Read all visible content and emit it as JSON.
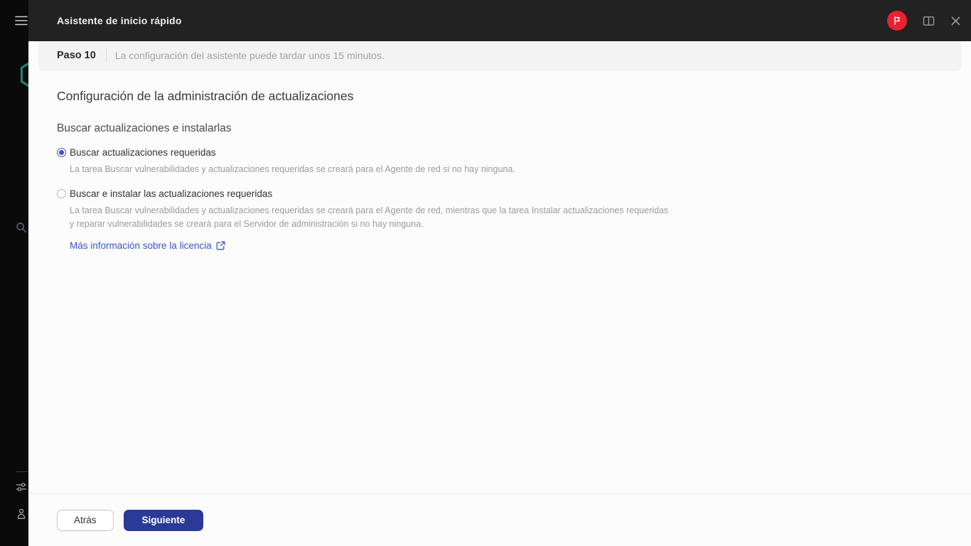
{
  "topbar": {
    "title": "Asistente de inicio rápido"
  },
  "stepbar": {
    "step": "Paso 10",
    "note": "La configuración del asistente puede tardar unos 15 minutos."
  },
  "content": {
    "heading": "Configuración de la administración de actualizaciones",
    "subheading": "Buscar actualizaciones e instalarlas",
    "options": [
      {
        "label": "Buscar actualizaciones requeridas",
        "selected": true,
        "description": "La tarea Buscar vulnerabilidades y actualizaciones requeridas se creará para el Agente de red si no hay ninguna."
      },
      {
        "label": "Buscar e instalar las actualizaciones requeridas",
        "selected": false,
        "description": "La tarea Buscar vulnerabilidades y actualizaciones requeridas se creará para el Agente de red, mientras que la tarea Instalar actualizaciones requeridas y reparar vulnerabilidades se creará para el Servidor de administración si no hay ninguna."
      }
    ],
    "license_link_label": "Más información sobre la licencia"
  },
  "footer": {
    "back_label": "Atrás",
    "next_label": "Siguiente"
  },
  "colors": {
    "accent_blue": "#3b55c9",
    "primary_button_blue": "#2b3a97",
    "brand_red": "#e92231",
    "brand_teal": "#1e8573",
    "topbar_dark": "#222222",
    "sidebar_black": "#0a0a0a"
  },
  "icons": {
    "sidebar": [
      "menu-icon",
      "brand-hexagon-logo",
      "search-icon",
      "filter-sliders-icon",
      "user-icon"
    ],
    "topbar": [
      "flag-badge-icon",
      "book-icon",
      "close-icon"
    ],
    "inline": [
      "external-link-icon"
    ]
  }
}
